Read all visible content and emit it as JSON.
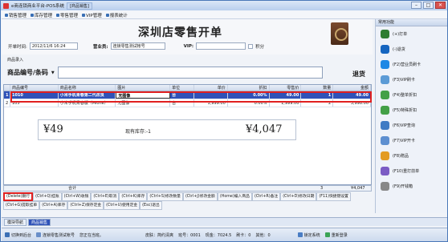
{
  "window": {
    "title": "e商连锁商业平台-POS系统",
    "tab": "[商品销售]",
    "btn_min": "–",
    "btn_max": "□",
    "btn_close": "✕"
  },
  "menu": [
    "销售管理",
    "库存管理",
    "零售管理",
    "VIP管理",
    "报表统计"
  ],
  "header": {
    "store_title": "深圳店零售开单",
    "open_time_label": "开单时间:",
    "open_time_value": "2012/11/6 16:24",
    "clerk_label": "营业员:",
    "clerk_value": "连锁零售测试帐号",
    "vip_label": "VIP:",
    "vip_value": "",
    "points_label": "积分"
  },
  "entry": {
    "section_label": "商品录入",
    "code_label": "商品编号/条码",
    "dropdown_arrow": "▼",
    "return_label": "退货"
  },
  "grid": {
    "columns": [
      "",
      "商品编号",
      "商品名称",
      "图片",
      "单位",
      "单价",
      "折扣",
      "零售价",
      "数量",
      "金额"
    ],
    "rows": [
      {
        "idx": "1",
        "code": "1010",
        "name": "小米手机青春第二代改良",
        "img": "无图像",
        "unit": "台",
        "price": "",
        "discount": "0.00%",
        "retail": "49.00",
        "qty": "1",
        "amount": "49.00"
      },
      {
        "idx": "2",
        "code": "105",
        "name": "小米手机青春版（Mione）",
        "img": "无图像",
        "unit": "台",
        "price": "1,999.00",
        "discount": "0.00%",
        "retail": "1,999.00",
        "qty": "2",
        "amount": "3,998.00"
      }
    ],
    "sum_label": "合计",
    "sum_qty": "3",
    "sum_amount": "¥4,047"
  },
  "display": {
    "unit_amount": "¥49",
    "stock": "现有库存:-1",
    "total": "¥4,047"
  },
  "shortcuts": [
    [
      "(Delete)删行",
      "(Ctrl+Q)挂账",
      "(Ctrl+W)收银",
      "(Ctrl+E)取消",
      "(Ctrl+K)库存",
      "(Ctrl+S)修改数量",
      "(Ctrl+J)修改金额",
      "(Home)编入商品",
      "(Ctrl+R)备注",
      "(Ctrl+D)修改日期",
      "(F11)快捷键设置"
    ],
    [
      "(Ctrl+G)提取挂单",
      "(Ctrl+A)库存",
      "(Ctrl+Z)保存定金",
      "(Ctrl+U)使用定金",
      "(Esc)退出"
    ]
  ],
  "functions": {
    "title": "常用功能",
    "items": [
      "(+)打单",
      "(-)退货",
      "(F2)营业员刷卡",
      "(F3)VIP刷卡",
      "(F4)整单折扣",
      "(F5)特殊折扣",
      "(F6)VIP查询",
      "(F7)VIP开卡",
      "(F8)赠品",
      "(F10)重打前单",
      "(F9)开钱箱"
    ],
    "colors": [
      "#2e7d32",
      "#1565c0",
      "#1e88e5",
      "#5c9bd6",
      "#43a047",
      "#43a047",
      "#3f7bc4",
      "#5d8fd0",
      "#e39b22",
      "#7b5cc4",
      "#888888"
    ]
  },
  "tabs": {
    "t1": "模块导航",
    "t2": "商品销售"
  },
  "status": {
    "s1": "切换到后台",
    "s2": "连锁零售测试帐号",
    "s3": "您正在当班。",
    "s4": "皮肤：简约清爽",
    "s5": "班号：0001",
    "s6": "现金：7024.5",
    "s7": "刷卡：0",
    "s8": "其他：0",
    "s9": "锁定系统",
    "s10": "重新登录"
  }
}
